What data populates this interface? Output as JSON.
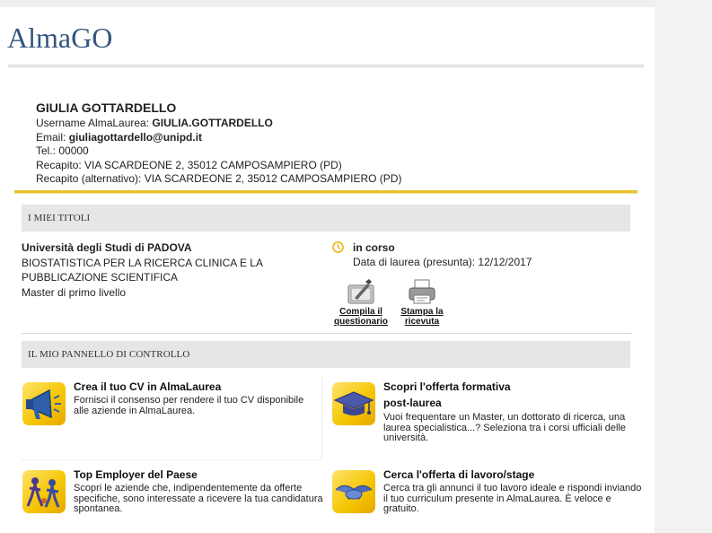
{
  "app": {
    "logo": "AlmaGO"
  },
  "profile": {
    "name": "GIULIA GOTTARDELLO",
    "username_label": "Username AlmaLaurea: ",
    "username": "GIULIA.GOTTARDELLO",
    "email_label": "Email: ",
    "email": "giuliagottardello@unipd.it",
    "tel": "Tel.: 00000",
    "address": "Recapito: VIA SCARDEONE 2, 35012 CAMPOSAMPIERO (PD)",
    "address_alt": "Recapito (alternativo): VIA SCARDEONE 2, 35012 CAMPOSAMPIERO (PD)"
  },
  "titles": {
    "section_label": "I MIEI TITOLI",
    "university": "Università degli Studi di PADOVA",
    "course": "BIOSTATISTICA PER LA RICERCA CLINICA E LA PUBBLICAZIONE SCIENTIFICA",
    "level": "Master di primo livello",
    "status": "in corso",
    "graduation": "Data di laurea (presunta): 12/12/2017",
    "actions": {
      "questionnaire_line1": "Compila il",
      "questionnaire_line2": "questionario",
      "print_line1": "Stampa la",
      "print_line2": "ricevuta"
    }
  },
  "panel": {
    "section_label": "IL MIO PANNELLO DI CONTROLLO",
    "cards": {
      "cv": {
        "title": "Crea il tuo CV in AlmaLaurea",
        "desc": "Fornisci il consenso per rendere il tuo CV disponibile alle aziende in AlmaLaurea.",
        "icon": "megaphone-icon"
      },
      "formazione": {
        "title": "Scopri l'offerta formativa",
        "subtitle": "post-laurea",
        "desc": "Vuoi frequentare un Master, un dottorato di ricerca, una laurea specialistica...? Seleziona tra i corsi ufficiali delle università.",
        "icon": "graduation-cap-icon"
      },
      "employer": {
        "title": "Top Employer del Paese",
        "desc": "Scopri le aziende che, indipendentemente da offerte specifiche, sono interessate a ricevere la tua candidatura spontanea.",
        "icon": "people-icon"
      },
      "lavoro": {
        "title": "Cerca l'offerta di lavoro/stage",
        "desc": "Cerca tra gli annunci il tuo lavoro ideale e rispondi inviando il tuo curriculum presente in AlmaLaurea. È veloce e gratuito.",
        "icon": "handshake-icon"
      }
    }
  },
  "colors": {
    "accent_gold": "#e8c22e",
    "logo_blue": "#33567f",
    "section_bg": "#e6e6e6"
  }
}
